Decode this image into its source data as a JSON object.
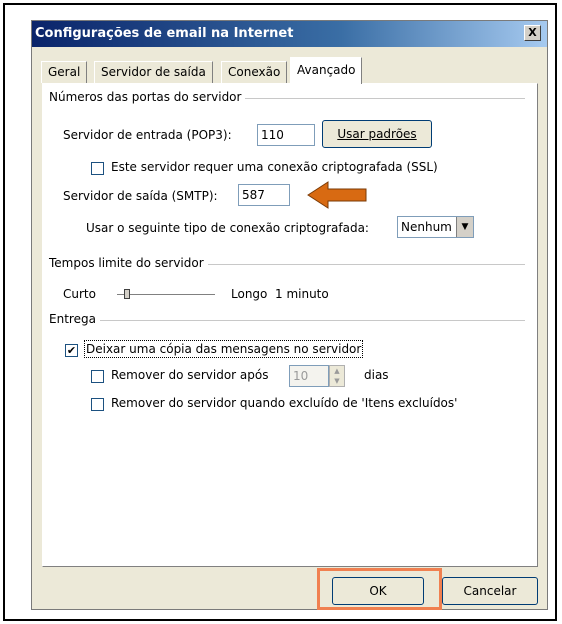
{
  "window": {
    "title": "Configurações de email na Internet",
    "close_label": "X"
  },
  "tabs": [
    {
      "label": "Geral"
    },
    {
      "label": "Servidor de saída"
    },
    {
      "label": "Conexão"
    },
    {
      "label": "Avançado",
      "active": true
    }
  ],
  "ports_group": {
    "title": "Números das portas do servidor",
    "incoming_label": "Servidor de entrada (POP3):",
    "incoming_value": "110",
    "use_defaults_label": "Usar padrões",
    "ssl_label": "Este servidor requer uma conexão criptografada (SSL)",
    "ssl_checked": false,
    "outgoing_label": "Servidor de saída (SMTP):",
    "outgoing_value": "587",
    "encryption_label": "Usar o seguinte tipo de conexão criptografada:",
    "encryption_value": "Nenhum"
  },
  "timeout_group": {
    "title": "Tempos limite do servidor",
    "short_label": "Curto",
    "long_label": "Longo",
    "value_text": "1 minuto",
    "level": 0.1
  },
  "delivery_group": {
    "title": "Entrega",
    "leave_copy_label": "Deixar uma cópia das mensagens no servidor",
    "leave_copy_checked": true,
    "remove_after_label": "Remover do servidor após",
    "remove_after_checked": false,
    "remove_after_days": "10",
    "days_label": "dias",
    "remove_deleted_label": "Remover do servidor quando excluído de 'Itens excluídos'",
    "remove_deleted_checked": false
  },
  "footer": {
    "ok_label": "OK",
    "cancel_label": "Cancelar"
  },
  "colors": {
    "arrow": "#d86a12",
    "highlight": "#f08050",
    "title_bar": "#0a246a"
  }
}
